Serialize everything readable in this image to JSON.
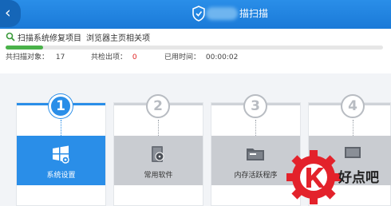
{
  "header": {
    "back_icon": "chevron-left-icon",
    "title": "描扫描",
    "shield_icon": "shield-icon"
  },
  "scan": {
    "items_text": "扫描系统修复项目",
    "items_text2": "浏览器主页相关项",
    "progress_percent": 10,
    "progress_color": "#4ab24a",
    "scanned_label": "共扫描对象：",
    "scanned_value": "17",
    "issues_label": "共检出项：",
    "issues_value": "0",
    "time_label": "已用时间：",
    "time_value": "00:00:02"
  },
  "steps": [
    {
      "number": "1",
      "label": "系统设置",
      "active": true,
      "icon": "windows-logo-icon"
    },
    {
      "number": "2",
      "label": "常用软件",
      "active": false,
      "icon": "software-box-icon"
    },
    {
      "number": "3",
      "label": "内存活跃程序",
      "active": false,
      "icon": "folder-icon"
    },
    {
      "number": "4",
      "label": "",
      "active": false,
      "icon": "monitor-icon"
    }
  ],
  "colors": {
    "accent": "#2a8ee8",
    "inactive_tile": "#c9ccd1",
    "issues_red": "#e02020",
    "watermark_red": "#e3222b"
  },
  "watermark": {
    "text": "好点吧",
    "logo": "k-gear-logo"
  }
}
